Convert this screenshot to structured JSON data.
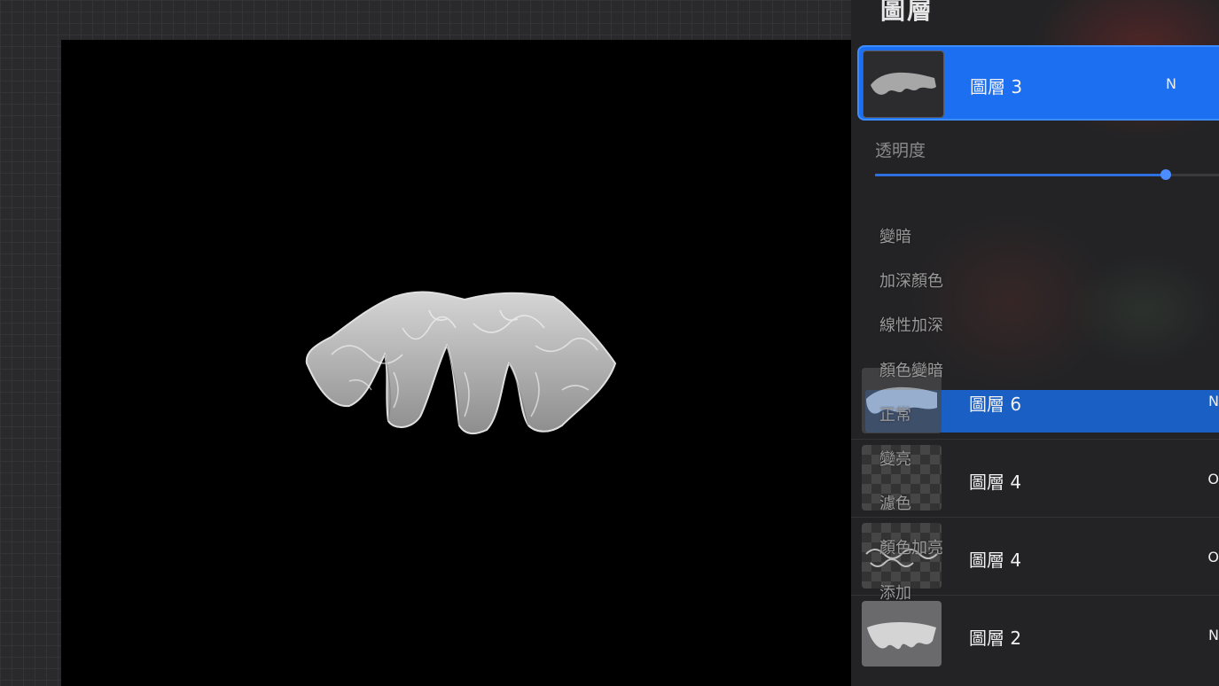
{
  "panel": {
    "title": "圖層"
  },
  "active_layer": {
    "name": "圖層 3",
    "mode": "N"
  },
  "opacity": {
    "label": "透明度",
    "value": 0.84
  },
  "blend_modes": [
    "變暗",
    "加深顏色",
    "線性加深",
    "顏色變暗",
    "正常",
    "變亮",
    "濾色",
    "顏色加亮",
    "添加"
  ],
  "layers": [
    {
      "name": "圖層 6",
      "mode": "N"
    },
    {
      "name": "圖層 4",
      "mode": "O"
    },
    {
      "name": "圖層 4",
      "mode": "O"
    },
    {
      "name": "圖層 2",
      "mode": "N"
    }
  ]
}
